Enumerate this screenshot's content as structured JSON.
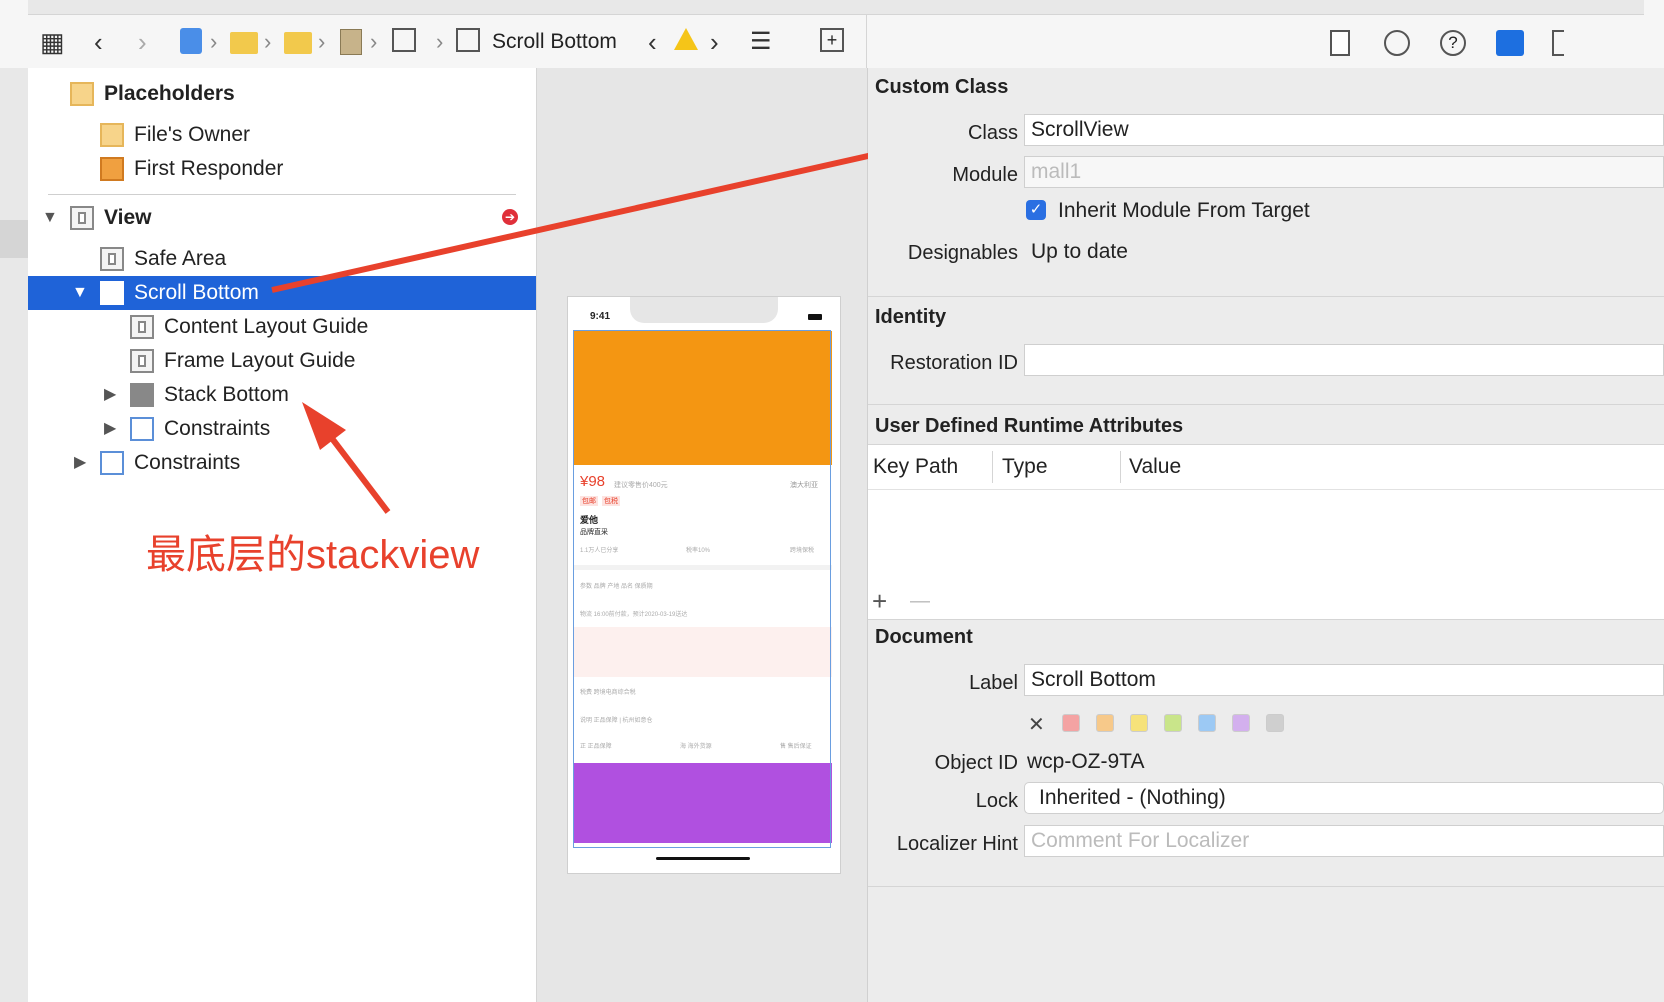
{
  "toolbar": {
    "breadcrumb_title": "Scroll Bottom"
  },
  "outline": {
    "placeholders": "Placeholders",
    "files_owner": "File's Owner",
    "first_responder": "First Responder",
    "view": "View",
    "safe_area": "Safe Area",
    "scroll_bottom": "Scroll Bottom",
    "content_layout_guide": "Content Layout Guide",
    "frame_layout_guide": "Frame Layout Guide",
    "stack_bottom": "Stack Bottom",
    "constraints_inner": "Constraints",
    "constraints_outer": "Constraints"
  },
  "annotation": {
    "text": "最底层的stackview"
  },
  "phone": {
    "time": "9:41",
    "price": "¥98",
    "price_note": "建议零售价400元",
    "tag1": "包邮",
    "tag2": "包税",
    "origin": "澳大利亚",
    "brand": "爱他",
    "brand_sub": "品牌直采",
    "shares": "1.1万人已分享",
    "tax": "税率10%",
    "cross": "跨境保税",
    "params": "参数    品牌 产地 品名 保质期",
    "logistics": "物流    16:00前付款，预计2020-03-19送达",
    "tax_fee": "税费    跨境电商综合税",
    "notes": "说明    正品保障 | 杭州如意仓",
    "guarantee1": "正  正品保障",
    "guarantee2": "海  海外货源",
    "guarantee3": "售  售后保证"
  },
  "inspector": {
    "custom_class": {
      "title": "Custom Class",
      "class_label": "Class",
      "class_value": "ScrollView",
      "module_label": "Module",
      "module_placeholder": "mall1",
      "inherit_label": "Inherit Module From Target",
      "designables_label": "Designables",
      "designables_value": "Up to date"
    },
    "identity": {
      "title": "Identity",
      "restoration_label": "Restoration ID",
      "restoration_value": ""
    },
    "runtime": {
      "title": "User Defined Runtime Attributes",
      "col_keypath": "Key Path",
      "col_type": "Type",
      "col_value": "Value",
      "add": "+",
      "remove": "—"
    },
    "document": {
      "title": "Document",
      "label_label": "Label",
      "label_value": "Scroll Bottom",
      "object_id_label": "Object ID",
      "object_id_value": "wcp-OZ-9TA",
      "lock_label": "Lock",
      "lock_value": "Inherited - (Nothing)",
      "hint_label": "Localizer Hint",
      "hint_placeholder": "Comment For Localizer"
    },
    "swatch_colors": [
      "#f4a3a3",
      "#f7c98a",
      "#f6e27a",
      "#c9e58a",
      "#9cc9f4",
      "#d3b0ee",
      "#cfcfcf"
    ]
  }
}
